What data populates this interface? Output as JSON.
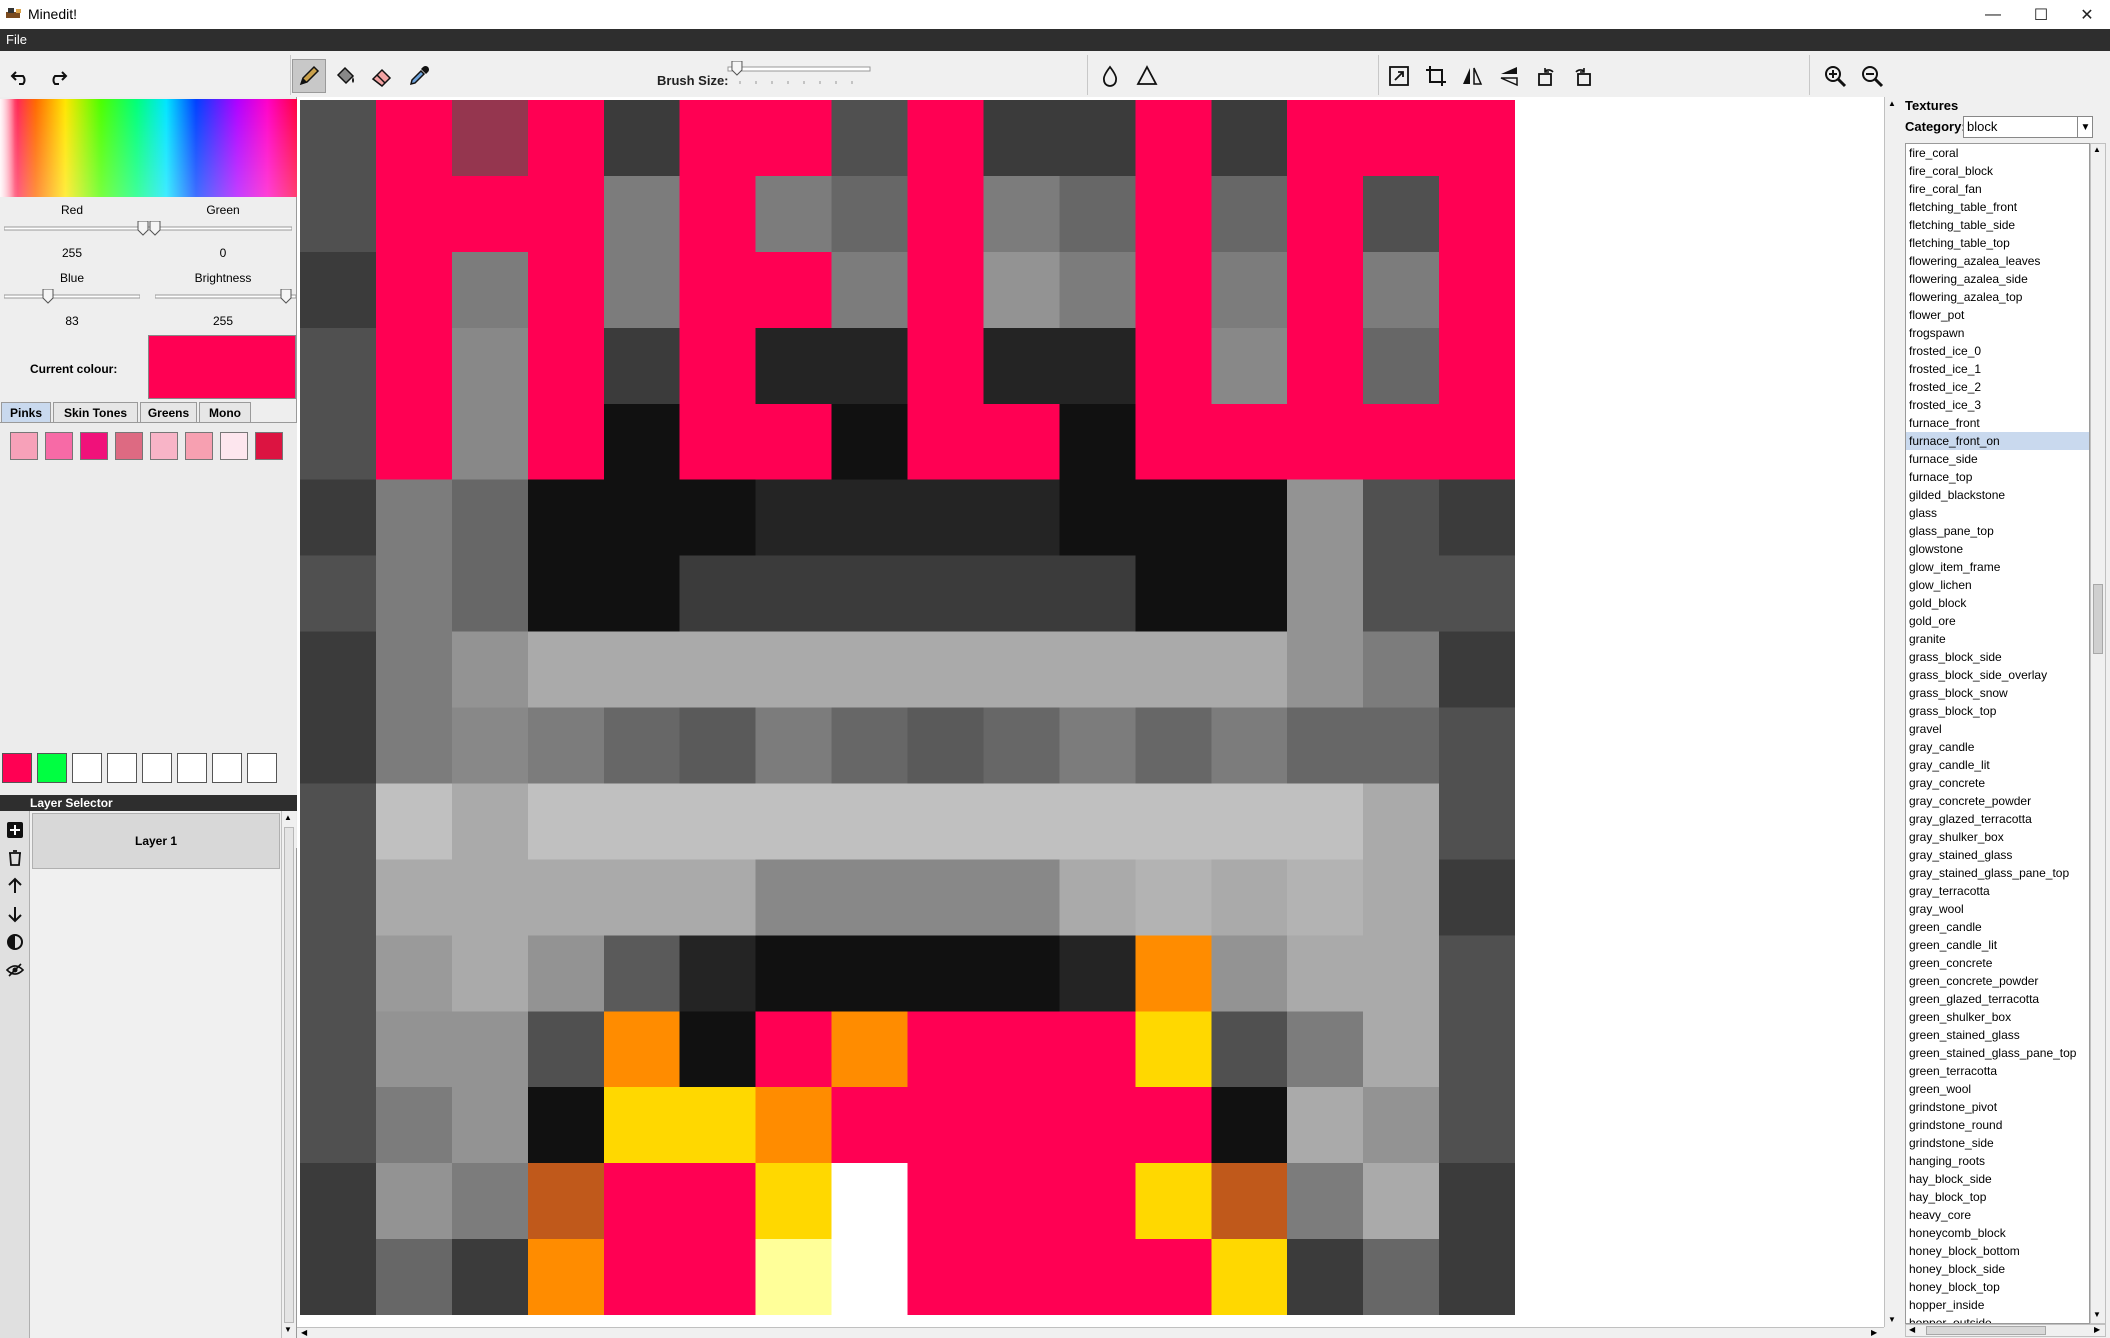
{
  "window": {
    "title": "Minedit!",
    "minimize_glyph": "—",
    "maximize_glyph": "☐",
    "close_glyph": "✕"
  },
  "menu": {
    "file": "File"
  },
  "toolbar": {
    "brush_size_label": "Brush Size:",
    "brush_size_value": 0.03,
    "tools": [
      {
        "name": "undo-icon"
      },
      {
        "name": "redo-icon"
      },
      {
        "name": "pencil-icon",
        "active": true
      },
      {
        "name": "fill-bucket-icon"
      },
      {
        "name": "eraser-icon"
      },
      {
        "name": "eyedropper-icon"
      },
      {
        "name": "water-drop-icon"
      },
      {
        "name": "triangle-icon"
      },
      {
        "name": "resize-icon"
      },
      {
        "name": "crop-icon"
      },
      {
        "name": "flip-horizontal-icon"
      },
      {
        "name": "flip-vertical-icon"
      },
      {
        "name": "rotate-left-icon"
      },
      {
        "name": "rotate-right-icon"
      },
      {
        "name": "zoom-in-icon"
      },
      {
        "name": "zoom-out-icon"
      }
    ]
  },
  "colour": {
    "red_label": "Red",
    "red_value": "255",
    "green_label": "Green",
    "green_value": "0",
    "blue_label": "Blue",
    "blue_value": "83",
    "brightness_label": "Brightness",
    "brightness_value": "255",
    "current_label": "Current colour:",
    "current_hex": "#ff0053"
  },
  "palette": {
    "tabs": [
      "Pinks",
      "Skin Tones",
      "Greens",
      "Mono"
    ],
    "active_tab": "Pinks",
    "swatches": [
      "#f7a1b9",
      "#f76aa6",
      "#f0117a",
      "#dd6a82",
      "#f8b4c7",
      "#f7a0b1",
      "#fde6ee",
      "#dc1441"
    ]
  },
  "recent_colours": [
    "#ff0053",
    "#00ff41",
    "#ffffff",
    "#ffffff",
    "#ffffff",
    "#ffffff",
    "#ffffff",
    "#ffffff"
  ],
  "layers": {
    "header": "Layer Selector",
    "items": [
      "Layer 1"
    ],
    "tools": [
      "add-layer-icon",
      "delete-layer-icon",
      "move-up-icon",
      "move-down-icon",
      "opacity-icon",
      "hide-layer-icon"
    ]
  },
  "canvas": {
    "width": 16,
    "height": 16,
    "pixels": [
      [
        "#505050",
        "#ff0053",
        "#95364f",
        "#ff0053",
        "#3b3b3b",
        "#ff0053",
        "#ff0053",
        "#505050",
        "#ff0053",
        "#3b3b3b",
        "#3b3b3b",
        "#ff0053",
        "#3b3b3b",
        "#ff0053",
        "#ff0053",
        "#ff0053"
      ],
      [
        "#505050",
        "#ff0053",
        "#ff0053",
        "#ff0053",
        "#7c7c7c",
        "#ff0053",
        "#7c7c7c",
        "#676767",
        "#ff0053",
        "#7c7c7c",
        "#676767",
        "#ff0053",
        "#676767",
        "#ff0053",
        "#505050",
        "#ff0053"
      ],
      [
        "#3b3b3b",
        "#ff0053",
        "#7c7c7c",
        "#ff0053",
        "#7c7c7c",
        "#ff0053",
        "#ff0053",
        "#7c7c7c",
        "#ff0053",
        "#939393",
        "#7c7c7c",
        "#ff0053",
        "#7c7c7c",
        "#ff0053",
        "#7c7c7c",
        "#ff0053"
      ],
      [
        "#505050",
        "#ff0053",
        "#888888",
        "#ff0053",
        "#3b3b3b",
        "#ff0053",
        "#242424",
        "#242424",
        "#ff0053",
        "#242424",
        "#242424",
        "#ff0053",
        "#888888",
        "#ff0053",
        "#676767",
        "#ff0053"
      ],
      [
        "#505050",
        "#ff0053",
        "#888888",
        "#ff0053",
        "#111111",
        "#ff0053",
        "#ff0053",
        "#111111",
        "#ff0053",
        "#ff0053",
        "#111111",
        "#ff0053",
        "#ff0053",
        "#ff0053",
        "#ff0053",
        "#ff0053"
      ],
      [
        "#3b3b3b",
        "#7c7c7c",
        "#676767",
        "#111111",
        "#111111",
        "#111111",
        "#242424",
        "#242424",
        "#242424",
        "#242424",
        "#111111",
        "#111111",
        "#111111",
        "#939393",
        "#505050",
        "#3b3b3b"
      ],
      [
        "#505050",
        "#7c7c7c",
        "#676767",
        "#111111",
        "#111111",
        "#3b3b3b",
        "#3b3b3b",
        "#3b3b3b",
        "#3b3b3b",
        "#3b3b3b",
        "#3b3b3b",
        "#111111",
        "#111111",
        "#939393",
        "#505050",
        "#505050"
      ],
      [
        "#3b3b3b",
        "#7c7c7c",
        "#939393",
        "#aaaaaa",
        "#aaaaaa",
        "#aaaaaa",
        "#aaaaaa",
        "#aaaaaa",
        "#aaaaaa",
        "#aaaaaa",
        "#aaaaaa",
        "#aaaaaa",
        "#aaaaaa",
        "#939393",
        "#7c7c7c",
        "#3b3b3b"
      ],
      [
        "#3b3b3b",
        "#7c7c7c",
        "#888888",
        "#7c7c7c",
        "#676767",
        "#5a5a5a",
        "#7c7c7c",
        "#676767",
        "#5a5a5a",
        "#676767",
        "#7c7c7c",
        "#676767",
        "#7c7c7c",
        "#676767",
        "#676767",
        "#505050"
      ],
      [
        "#505050",
        "#c0c0c0",
        "#aaaaaa",
        "#c0c0c0",
        "#c0c0c0",
        "#c0c0c0",
        "#c0c0c0",
        "#c0c0c0",
        "#c0c0c0",
        "#c0c0c0",
        "#c0c0c0",
        "#c0c0c0",
        "#c0c0c0",
        "#c0c0c0",
        "#aaaaaa",
        "#505050"
      ],
      [
        "#505050",
        "#aaaaaa",
        "#aaaaaa",
        "#aaaaaa",
        "#aaaaaa",
        "#aaaaaa",
        "#888888",
        "#888888",
        "#888888",
        "#888888",
        "#aaaaaa",
        "#b3b3b3",
        "#aaaaaa",
        "#b3b3b3",
        "#aaaaaa",
        "#3b3b3b"
      ],
      [
        "#505050",
        "#9a9a9a",
        "#aaaaaa",
        "#939393",
        "#5a5a5a",
        "#242424",
        "#111111",
        "#111111",
        "#111111",
        "#111111",
        "#242424",
        "#ff8c00",
        "#939393",
        "#aaaaaa",
        "#aaaaaa",
        "#505050"
      ],
      [
        "#505050",
        "#939393",
        "#939393",
        "#505050",
        "#ff8c00",
        "#111111",
        "#ff0053",
        "#ff8c00",
        "#ff0053",
        "#ff0053",
        "#ff0053",
        "#ffd800",
        "#505050",
        "#7c7c7c",
        "#aaaaaa",
        "#505050"
      ],
      [
        "#505050",
        "#7c7c7c",
        "#939393",
        "#111111",
        "#ffd800",
        "#ffd800",
        "#ff8c00",
        "#ff0053",
        "#ff0053",
        "#ff0053",
        "#ff0053",
        "#ff0053",
        "#111111",
        "#aaaaaa",
        "#939393",
        "#505050"
      ],
      [
        "#3b3b3b",
        "#939393",
        "#7c7c7c",
        "#c0591b",
        "#ff0053",
        "#ff0053",
        "#ffd800",
        "#ffffff",
        "#ff0053",
        "#ff0053",
        "#ff0053",
        "#ffd800",
        "#c0591b",
        "#7c7c7c",
        "#aaaaaa",
        "#3b3b3b"
      ],
      [
        "#3b3b3b",
        "#676767",
        "#3b3b3b",
        "#ff8c00",
        "#ff0053",
        "#ff0053",
        "#ffff99",
        "#ffffff",
        "#ff0053",
        "#ff0053",
        "#ff0053",
        "#ff0053",
        "#ffd800",
        "#3b3b3b",
        "#676767",
        "#3b3b3b"
      ]
    ]
  },
  "textures": {
    "title": "Textures",
    "category_label": "Category:",
    "category_value": "block",
    "selected": "furnace_front_on",
    "items": [
      "fire_coral",
      "fire_coral_block",
      "fire_coral_fan",
      "fletching_table_front",
      "fletching_table_side",
      "fletching_table_top",
      "flowering_azalea_leaves",
      "flowering_azalea_side",
      "flowering_azalea_top",
      "flower_pot",
      "frogspawn",
      "frosted_ice_0",
      "frosted_ice_1",
      "frosted_ice_2",
      "frosted_ice_3",
      "furnace_front",
      "furnace_front_on",
      "furnace_side",
      "furnace_top",
      "gilded_blackstone",
      "glass",
      "glass_pane_top",
      "glowstone",
      "glow_item_frame",
      "glow_lichen",
      "gold_block",
      "gold_ore",
      "granite",
      "grass_block_side",
      "grass_block_side_overlay",
      "grass_block_snow",
      "grass_block_top",
      "gravel",
      "gray_candle",
      "gray_candle_lit",
      "gray_concrete",
      "gray_concrete_powder",
      "gray_glazed_terracotta",
      "gray_shulker_box",
      "gray_stained_glass",
      "gray_stained_glass_pane_top",
      "gray_terracotta",
      "gray_wool",
      "green_candle",
      "green_candle_lit",
      "green_concrete",
      "green_concrete_powder",
      "green_glazed_terracotta",
      "green_shulker_box",
      "green_stained_glass",
      "green_stained_glass_pane_top",
      "green_terracotta",
      "green_wool",
      "grindstone_pivot",
      "grindstone_round",
      "grindstone_side",
      "hanging_roots",
      "hay_block_side",
      "hay_block_top",
      "heavy_core",
      "honeycomb_block",
      "honey_block_bottom",
      "honey_block_side",
      "honey_block_top",
      "hopper_inside",
      "hopper_outside"
    ]
  }
}
